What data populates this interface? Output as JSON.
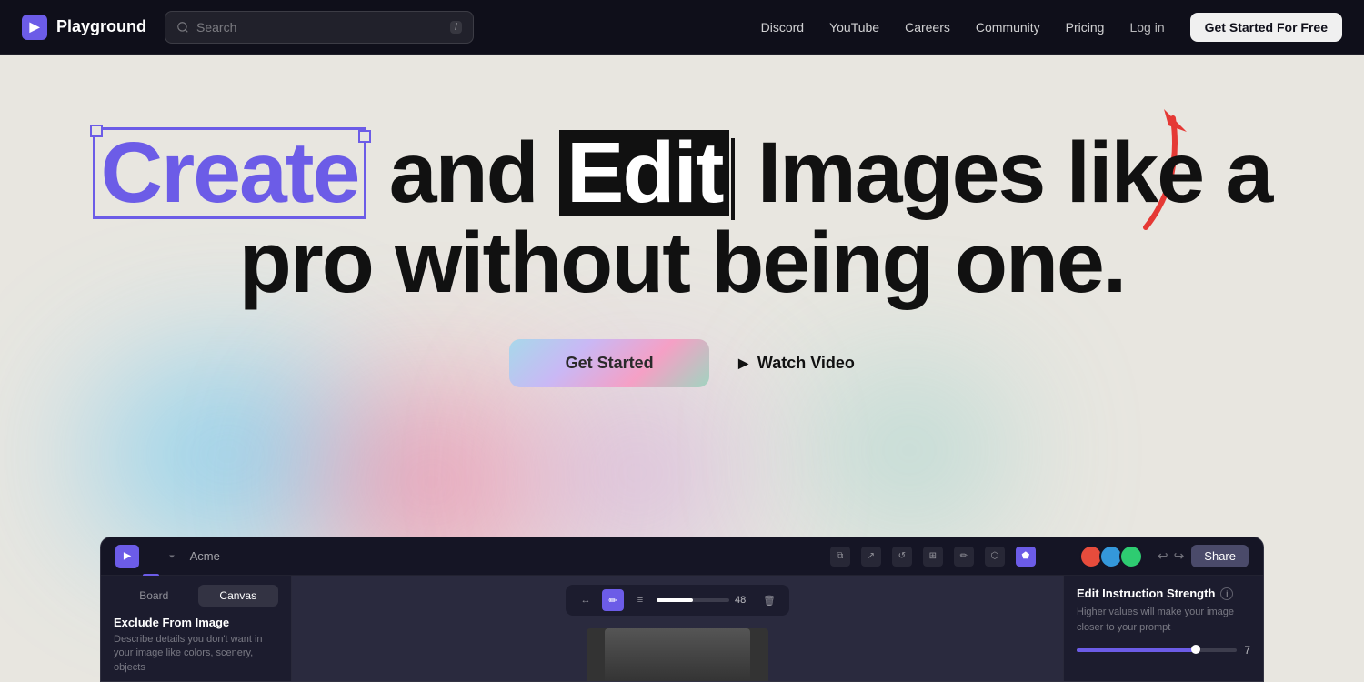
{
  "nav": {
    "logo_text": "Playground",
    "logo_icon": "▶",
    "search_placeholder": "Search",
    "search_shortcut": "/",
    "links": [
      {
        "label": "Discord",
        "id": "discord"
      },
      {
        "label": "YouTube",
        "id": "youtube"
      },
      {
        "label": "Careers",
        "id": "careers"
      },
      {
        "label": "Community",
        "id": "community"
      },
      {
        "label": "Pricing",
        "id": "pricing"
      },
      {
        "label": "Log in",
        "id": "login"
      },
      {
        "label": "Get Started For Free",
        "id": "cta"
      }
    ]
  },
  "hero": {
    "headline_part1": "Create",
    "headline_and": "and",
    "headline_edit": "Edit",
    "headline_rest": "Images like a",
    "headline_line2": "pro without being one.",
    "btn_get_started": "Get Started",
    "btn_watch_video": "Watch Video"
  },
  "app_preview": {
    "name": "Acme",
    "share_label": "Share",
    "tabs": [
      {
        "label": "Board",
        "active": false
      },
      {
        "label": "Canvas",
        "active": true
      }
    ],
    "sidebar_section": {
      "title": "Exclude From Image",
      "description": "Describe details you don't want in your image like colors, scenery, objects"
    },
    "toolbar": {
      "slider_value": "48"
    },
    "right_panel": {
      "title": "Edit Instruction Strength",
      "description": "Higher values will make your image closer to your prompt",
      "value": "7"
    }
  }
}
